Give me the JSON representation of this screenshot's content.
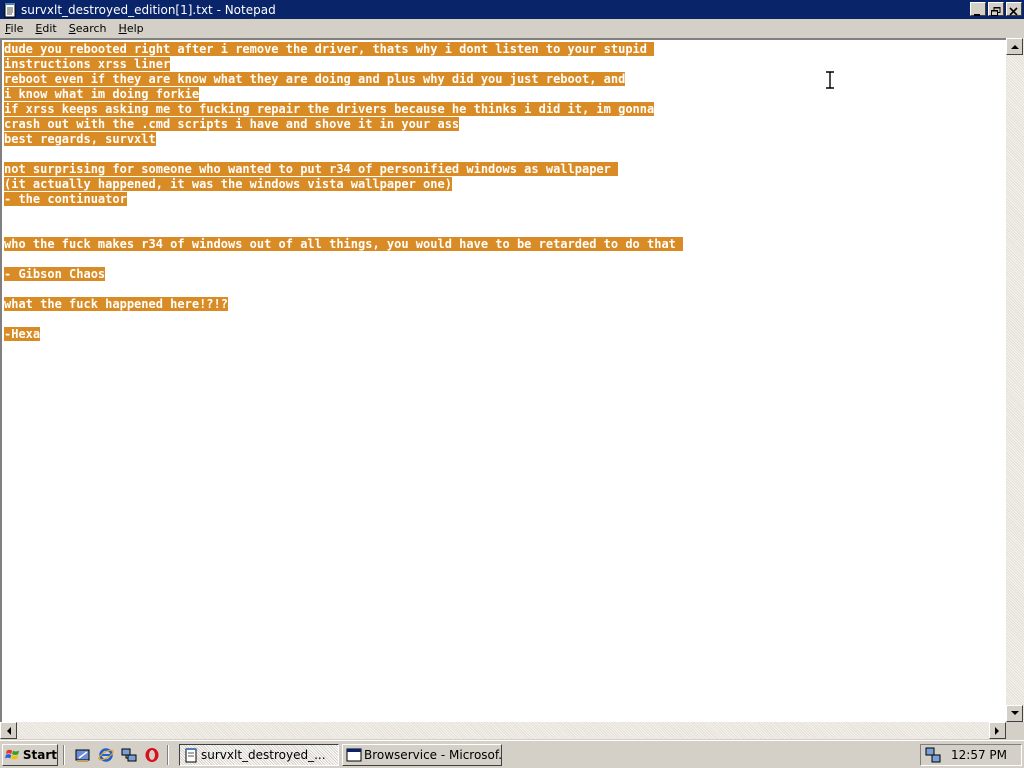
{
  "window": {
    "title": "survxlt_destroyed_edition[1].txt - Notepad"
  },
  "menu": [
    {
      "label": "File",
      "underline": "F",
      "rest": "ile"
    },
    {
      "label": "Edit",
      "underline": "E",
      "rest": "dit"
    },
    {
      "label": "Search",
      "underline": "S",
      "rest": "earch"
    },
    {
      "label": "Help",
      "underline": "H",
      "rest": "elp"
    }
  ],
  "editor": {
    "lines": [
      "dude you rebooted right after i remove the driver, thats why i dont listen to your stupid ",
      "instructions xrss liner",
      "reboot even if they are know what they are doing and plus why did you just reboot, and",
      "i know what im doing forkie",
      "if xrss keeps asking me to fucking repair the drivers because he thinks i did it, im gonna",
      "crash out with the .cmd scripts i have and shove it in your ass",
      "best regards, survxlt",
      "",
      "not surprising for someone who wanted to put r34 of personified windows as wallpaper ",
      "(it actually happened, it was the windows vista wallpaper one)",
      "- the continuator",
      "",
      "",
      "who the fuck makes r34 of windows out of all things, you would have to be retarded to do that ",
      "",
      "- Gibson Chaos",
      "",
      "what the fuck happened here!?!?",
      "",
      "-Hexa"
    ],
    "selection_color": "#d98c25"
  },
  "taskbar": {
    "start_label": "Start",
    "tasks": [
      {
        "label": "survxlt_destroyed_...",
        "active": true
      },
      {
        "label": "Browservice - Microsof...",
        "active": false
      }
    ],
    "clock": "12:57 PM"
  }
}
